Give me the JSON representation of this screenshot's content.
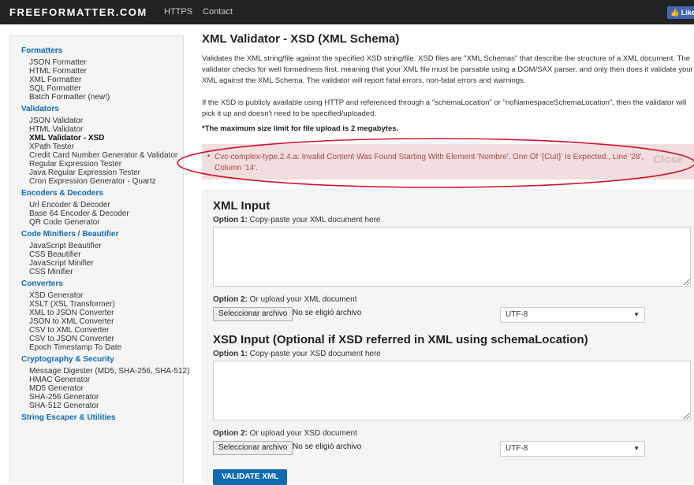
{
  "header": {
    "brand": "FREEFORMATTER.COM",
    "nav": [
      "HTTPS",
      "Contact"
    ],
    "like": "Like 1K"
  },
  "sidebar": [
    {
      "category": "Formatters",
      "items": [
        "JSON Formatter",
        "HTML Formatter",
        "XML Formatter",
        "SQL Formatter",
        "Batch Formatter (new!)"
      ]
    },
    {
      "category": "Validators",
      "items": [
        "JSON Validator",
        "HTML Validator",
        "XML Validator - XSD",
        "XPath Tester",
        "Credit Card Number Generator & Validator",
        "Regular Expression Tester",
        "Java Regular Expression Tester",
        "Cron Expression Generator - Quartz"
      ]
    },
    {
      "category": "Encoders & Decoders",
      "items": [
        "Url Encoder & Decoder",
        "Base 64 Encoder & Decoder",
        "QR Code Generator"
      ]
    },
    {
      "category": "Code Minifiers / Beautifier",
      "items": [
        "JavaScript Beautifier",
        "CSS Beautifier",
        "JavaScript Minifier",
        "CSS Minifier"
      ]
    },
    {
      "category": "Converters",
      "items": [
        "XSD Generator",
        "XSLT (XSL Transformer)",
        "XML to JSON Converter",
        "JSON to XML Converter",
        "CSV to XML Converter",
        "CSV to JSON Converter",
        "Epoch Timestamp To Date"
      ]
    },
    {
      "category": "Cryptography & Security",
      "items": [
        "Message Digester (MD5, SHA-256, SHA-512)",
        "HMAC Generator",
        "MD5 Generator",
        "SHA-256 Generator",
        "SHA-512 Generator"
      ]
    },
    {
      "category": "String Escaper & Utilities",
      "items": []
    }
  ],
  "active_item": "XML Validator - XSD",
  "main": {
    "title": "XML Validator - XSD (XML Schema)",
    "intro": "Validates the XML string/file against the specified XSD string/file. XSD files are \"XML Schemas\" that describe the structure of a XML document. The validator checks for well formedness first, meaning that your XML file must be parsable using a DOM/SAX parser, and only then does it validate your XML against the XML Schema. The validator will report fatal errors, non-fatal errors and warnings.",
    "schema_note": "If the XSD is publicly available using HTTP and referenced through a \"schemaLocation\" or \"noNamespaceSchemaLocation\", then the validator will pick it up and doesn't need to be specified/uploaded.",
    "limit_note": "*The maximum size limit for file upload is 2 megabytes.",
    "error": "Cvc-complex-type.2.4.a: Invalid Content Was Found Starting With Element 'Nombre'. One Of '{Cuit}' Is Expected., Line '28', Column '14'.",
    "close": "Close",
    "xml_input": {
      "heading": "XML Input",
      "opt1_label": "Option 1:",
      "opt1_text": "Copy-paste your XML document here",
      "opt2_label": "Option 2:",
      "opt2_text": "Or upload your XML document",
      "file_button": "Seleccionar archivo",
      "file_status": "No se eligió archivo",
      "encoding": "UTF-8"
    },
    "xsd_input": {
      "heading": "XSD Input (Optional if XSD referred in XML using schemaLocation)",
      "opt1_label": "Option 1:",
      "opt1_text": "Copy-paste your XSD document here",
      "opt2_label": "Option 2:",
      "opt2_text": "Or upload your XSD document",
      "file_button": "Seleccionar archivo",
      "file_status": "No se eligió archivo",
      "encoding": "UTF-8"
    },
    "validate_button": "VALIDATE XML"
  },
  "colors": {
    "topbar": "#222222",
    "link": "#0f6ab4",
    "error_bg": "#f2dede",
    "error_text": "#a94442",
    "annotation": "#d2142a"
  },
  "icons": {
    "like": "thumbs-up-icon",
    "select": "chevron-down-icon",
    "annotation": "red-ellipse"
  }
}
